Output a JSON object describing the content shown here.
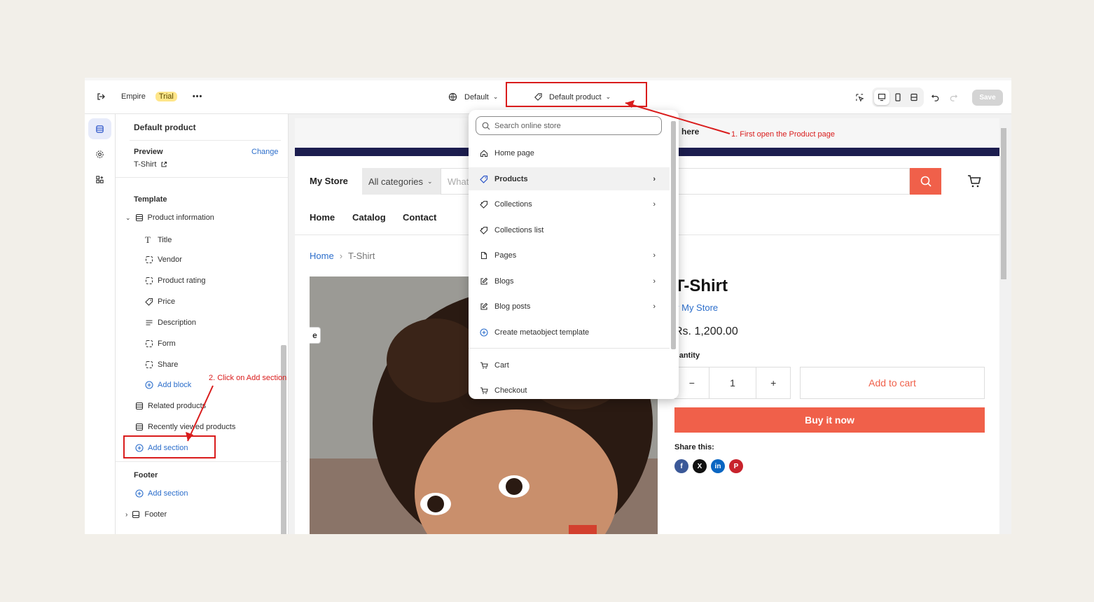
{
  "topbar": {
    "theme_name": "Empire",
    "trial_badge": "Trial",
    "more_label": "•••",
    "default_label": "Default",
    "template_selector": "Default product",
    "save_label": "Save"
  },
  "panel": {
    "title": "Default product",
    "preview_label": "Preview",
    "preview_value": "T-Shirt",
    "change_label": "Change",
    "template_label": "Template",
    "product_information": "Product information",
    "blocks": [
      "Title",
      "Vendor",
      "Product rating",
      "Price",
      "Description",
      "Form",
      "Share"
    ],
    "add_block": "Add block",
    "related_products": "Related products",
    "recently_viewed": "Recently viewed products",
    "add_section": "Add section",
    "footer_label": "Footer",
    "footer_add_section": "Add section",
    "footer_item": "Footer"
  },
  "store": {
    "announcement": "here",
    "store_name": "My Store",
    "category_select": "All categories",
    "search_placeholder": "What",
    "nav": [
      "Home",
      "Catalog",
      "Contact"
    ],
    "breadcrumb_home": "Home",
    "breadcrumb_current": "T-Shirt",
    "breadcrumb_sep": "›",
    "side_chip": "e",
    "product_title": "T-Shirt",
    "vendor": "y My Store",
    "price": "Rs. 1,200.00",
    "quantity_label": "uantity",
    "quantity_minus": "−",
    "quantity_value": "1",
    "quantity_plus": "+",
    "add_to_cart": "Add to cart",
    "buy_now": "Buy it now",
    "share_label": "Share this:"
  },
  "dropdown": {
    "search_placeholder": "Search online store",
    "items": [
      {
        "label": "Home page",
        "icon": "home-icon"
      },
      {
        "label": "Products",
        "icon": "tag-icon"
      },
      {
        "label": "Collections",
        "icon": "collection-icon"
      },
      {
        "label": "Collections list",
        "icon": "collection-icon"
      },
      {
        "label": "Pages",
        "icon": "page-icon"
      },
      {
        "label": "Blogs",
        "icon": "edit-icon"
      },
      {
        "label": "Blog posts",
        "icon": "edit-icon"
      },
      {
        "label": "Create metaobject template",
        "icon": "plus-circle-icon"
      },
      {
        "label": "Cart",
        "icon": "cart-icon"
      },
      {
        "label": "Checkout",
        "icon": "cart-icon"
      }
    ]
  },
  "annotations": {
    "step1": "1. First open the Product page",
    "step2": "2. Click on Add section"
  },
  "colors": {
    "accent": "#f0604a",
    "link": "#2c6ecb",
    "navy": "#1c1d4f",
    "annotation": "#d91c1c",
    "trial": "#ffe68a"
  }
}
